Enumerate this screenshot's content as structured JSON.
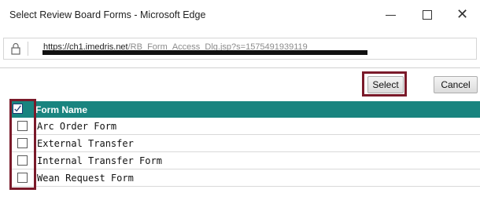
{
  "window": {
    "title": "Select Review Board Forms - Microsoft Edge",
    "minimize_icon": "minimize-icon",
    "maximize_icon": "maximize-icon",
    "close_icon": "close-icon"
  },
  "address_bar": {
    "url_host": "https://ch1.imedris.net",
    "url_path": "/RB_Form_Access_Dlg.jsp?s=1575491939119",
    "lock_icon": "lock-icon"
  },
  "toolbar": {
    "select_label": "Select",
    "cancel_label": "Cancel"
  },
  "grid": {
    "header": "Form Name",
    "select_all_icon": "select-all-checkbox-icon",
    "rows": [
      {
        "label": "Arc Order Form",
        "checked": false
      },
      {
        "label": "External Transfer",
        "checked": false
      },
      {
        "label": "Internal Transfer Form",
        "checked": false
      },
      {
        "label": "Wean Request Form",
        "checked": false
      }
    ]
  },
  "colors": {
    "header_bg": "#19847f",
    "highlight": "#7a1a2a"
  }
}
